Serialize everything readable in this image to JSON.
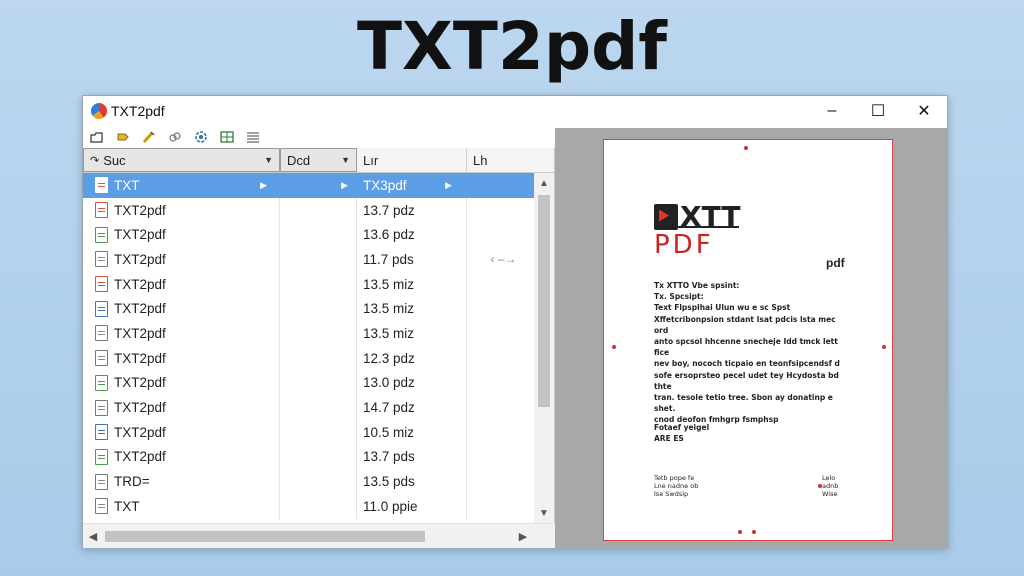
{
  "hero_title": "TXT2pdf",
  "window": {
    "title": "TXT2pdf",
    "controls": {
      "minimize": "–",
      "maximize": "☐",
      "close": "✕"
    }
  },
  "toolbar": {
    "icons": [
      "open-icon",
      "tag-icon",
      "highlight-icon",
      "link-icon",
      "settings-icon",
      "grid-icon",
      "list-icon"
    ]
  },
  "columns": [
    {
      "label": "Suc",
      "dropdown": true
    },
    {
      "label": "Dcd",
      "dropdown": true
    },
    {
      "label": "Lır",
      "dropdown": false
    },
    {
      "label": "Lh",
      "dropdown": false
    }
  ],
  "rows": [
    {
      "name": "TXT",
      "size": "TX3pdf",
      "selected": true,
      "icon": "red"
    },
    {
      "name": "TXT2pdf",
      "size": "13.7 pdz",
      "icon": "red"
    },
    {
      "name": "TXT2pdf",
      "size": "13.6 pdz",
      "icon": "green"
    },
    {
      "name": "TXT2pdf",
      "size": "11.7 pds",
      "icon": "plain",
      "extra": "‹ –→"
    },
    {
      "name": "TXT2pdf",
      "size": "13.5 miz",
      "icon": "red"
    },
    {
      "name": "TXT2pdf",
      "size": "13.5 miz",
      "icon": "blue"
    },
    {
      "name": "TXT2pdf",
      "size": "13.5 miz",
      "icon": "plain"
    },
    {
      "name": "TXT2pdf",
      "size": "12.3 pdz",
      "icon": "plain"
    },
    {
      "name": "TXT2pdf",
      "size": "13.0 pdz",
      "icon": "green"
    },
    {
      "name": "TXT2pdf",
      "size": "14.7 pdz",
      "icon": "plain"
    },
    {
      "name": "TXT2pdf",
      "size": "10.5 miz",
      "icon": "blue"
    },
    {
      "name": "TXT2pdf",
      "size": "13.7 pds",
      "icon": "green"
    },
    {
      "name": "TRD=",
      "size": "13.5 pds",
      "icon": "plain"
    },
    {
      "name": "TXT",
      "size": "11.0 ppie",
      "icon": "plain"
    }
  ],
  "preview": {
    "logo_top": "XTT",
    "logo_bottom": "PDF",
    "mark": "pdf",
    "body_lines": [
      "Tx XTTO Vbe spsint:",
      "Tx. Spcsipt:",
      "Text Flpsplhai Ulun wu e sc Spst",
      "Xffetcribonpsion stdant Isat pdcis lsta mec ord",
      "anto spcsol hhcenne snecheje Idd tmck lett fice",
      "nev boy, nococh ticpaio en teonfsipcendsf d",
      "sofe ersoprsteo pecel udet tey Hcydosta bd thte",
      "tran. tesole tetio tree. Sbon ay donatinp e shet.",
      "cnod deofon fmhgrp fsmphsp"
    ],
    "signature_lines": [
      "Fotaef yeigel",
      "ARE ES"
    ],
    "footer_left": [
      "Tetb pope fe",
      "Lne nadne ob",
      "lse Swdsip"
    ],
    "footer_right": [
      "Lelo",
      "adnb",
      "Wise"
    ]
  }
}
